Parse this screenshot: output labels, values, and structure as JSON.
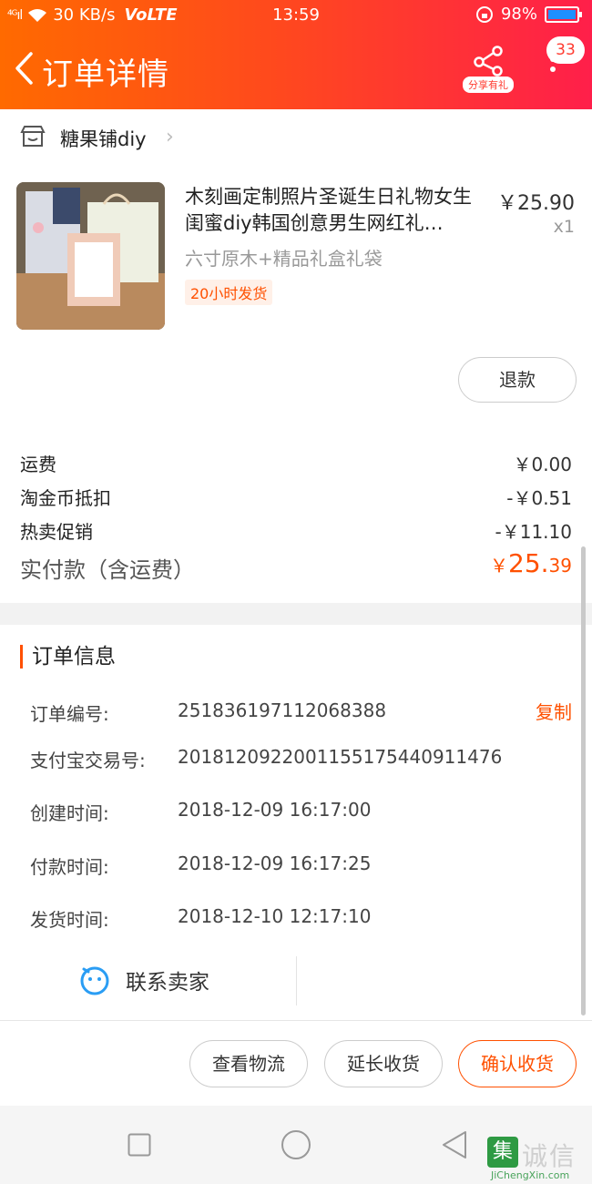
{
  "status_bar": {
    "signal": "⁴ᴳıl",
    "speed": "30 KB/s",
    "volte": "VoLTE",
    "time": "13:59",
    "battery": "98%"
  },
  "header": {
    "title": "订单详情",
    "share_label": "分享有礼",
    "badge_count": "33"
  },
  "shop": {
    "name": "糖果铺diy"
  },
  "product": {
    "title": "木刻画定制照片圣诞生日礼物女生闺蜜diy韩国创意男生网红礼…",
    "sku": "六寸原木+精品礼盒礼袋",
    "ship_tag": "20小时发货",
    "price": "￥25.90",
    "qty": "x1",
    "refund_label": "退款"
  },
  "fees": {
    "shipping_label": "运费",
    "shipping_value": "￥0.00",
    "coin_label": "淘金币抵扣",
    "coin_value": "-￥0.51",
    "promo_label": "热卖促销",
    "promo_value": "-￥11.10",
    "total_label": "实付款（含运费）",
    "total_yen": "￥",
    "total_int": "25.",
    "total_dec": "39"
  },
  "order_info": {
    "section_title": "订单信息",
    "order_no_label": "订单编号:",
    "order_no_value": "251836197112068388",
    "copy_label": "复制",
    "alipay_label": "支付宝交易号:",
    "alipay_value": "2018120922001155175440911476",
    "created_label": "创建时间:",
    "created_value": "2018-12-09 16:17:00",
    "paid_label": "付款时间:",
    "paid_value": "2018-12-09 16:17:25",
    "shipped_label": "发货时间:",
    "shipped_value": "2018-12-10 12:17:10"
  },
  "contact": {
    "label": "联系卖家"
  },
  "actions": {
    "logistics": "查看物流",
    "extend": "延长收货",
    "confirm": "确认收货"
  },
  "watermark": {
    "mark": "集",
    "chars": "诚信",
    "url": "JiChengXin.com"
  },
  "colors": {
    "header_start": "#ff6a00",
    "header_end": "#ff1f4a",
    "accent": "#ff5000"
  }
}
